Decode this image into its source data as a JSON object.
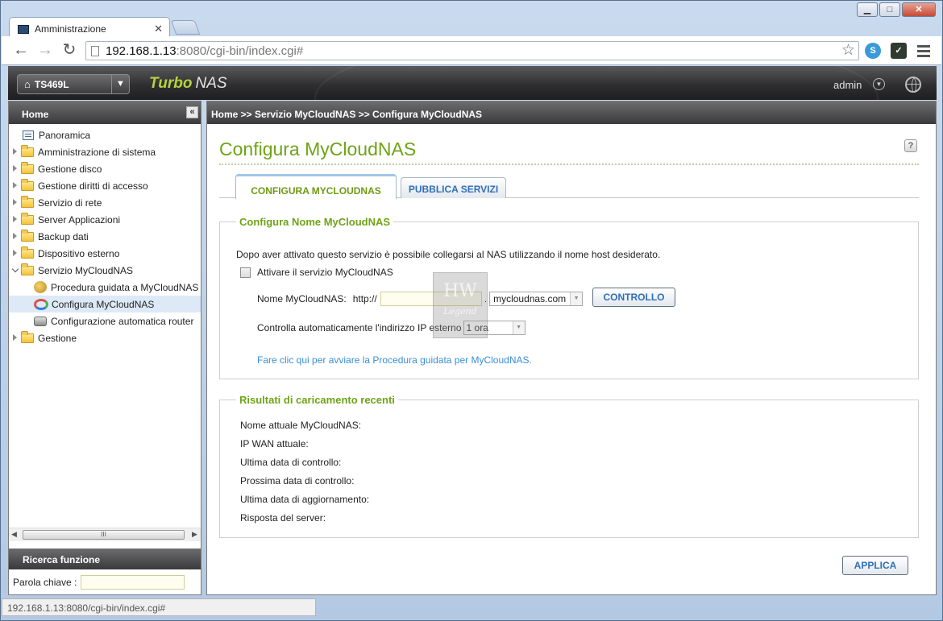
{
  "browser": {
    "tab_title": "Amministrazione",
    "tab_close": "✕",
    "url_host": "192.168.1.13",
    "url_rest": ":8080/cgi-bin/index.cgi#",
    "status_url": "192.168.1.13:8080/cgi-bin/index.cgi#",
    "win_minimize": "▁",
    "win_maximize": "□",
    "win_close": "✕"
  },
  "header": {
    "device": "TS469L",
    "brand_turbo": "Turbo",
    "brand_nas": "NAS",
    "user": "admin"
  },
  "sidebar": {
    "title": "Home",
    "items": [
      {
        "label": "Panoramica"
      },
      {
        "label": "Amministrazione di sistema"
      },
      {
        "label": "Gestione disco"
      },
      {
        "label": "Gestione diritti di accesso"
      },
      {
        "label": "Servizio di rete"
      },
      {
        "label": "Server Applicazioni"
      },
      {
        "label": "Backup dati"
      },
      {
        "label": "Dispositivo esterno"
      },
      {
        "label": "Servizio MyCloudNAS"
      },
      {
        "label": "Procedura guidata a MyCloudNAS"
      },
      {
        "label": "Configura MyCloudNAS"
      },
      {
        "label": "Configurazione automatica router"
      },
      {
        "label": "Gestione"
      }
    ],
    "scroll_grip": "III",
    "search_title": "Ricerca funzione",
    "search_label": "Parola chiave :"
  },
  "main": {
    "breadcrumb": "Home >> Servizio MyCloudNAS >> Configura MyCloudNAS",
    "title": "Configura MyCloudNAS",
    "tabs": [
      "CONFIGURA MYCLOUDNAS",
      "PUBBLICA SERVIZI"
    ],
    "config_group": {
      "legend": "Configura Nome MyCloudNAS",
      "description": "Dopo aver attivato questo servizio è possibile collegarsi al NAS utilizzando il nome host desiderato.",
      "enable_label": "Attivare il servizio MyCloudNAS",
      "name_label": "Nome MyCloudNAS:",
      "http_prefix": "http://",
      "dot": ".",
      "domain_value": "mycloudnas.com",
      "check_button": "CONTROLLO",
      "ip_check_label": "Controlla automaticamente l'indirizzo IP esterno",
      "ip_interval": "1 ora",
      "wizard_link": "Fare clic qui per avviare la Procedura guidata per MyCloudNAS."
    },
    "results_group": {
      "legend": "Risultati di caricamento recenti",
      "rows": [
        "Nome attuale MyCloudNAS:",
        "IP WAN attuale:",
        "Ultima data di controllo:",
        "Prossima data di controllo:",
        "Ultima data di aggiornamento:",
        "Risposta del server:"
      ]
    },
    "apply_button": "APPLICA"
  },
  "watermark": {
    "main": "HW",
    "sub": "Legend"
  },
  "colors": {
    "accent_green": "#6ea416",
    "link_blue": "#3a8fd6",
    "button_blue": "#2f6fb8"
  },
  "icons": [
    "page-icon",
    "star-icon",
    "menu-icon",
    "home-icon",
    "globe-icon",
    "folder-icon",
    "help-icon",
    "collapse-icon"
  ]
}
